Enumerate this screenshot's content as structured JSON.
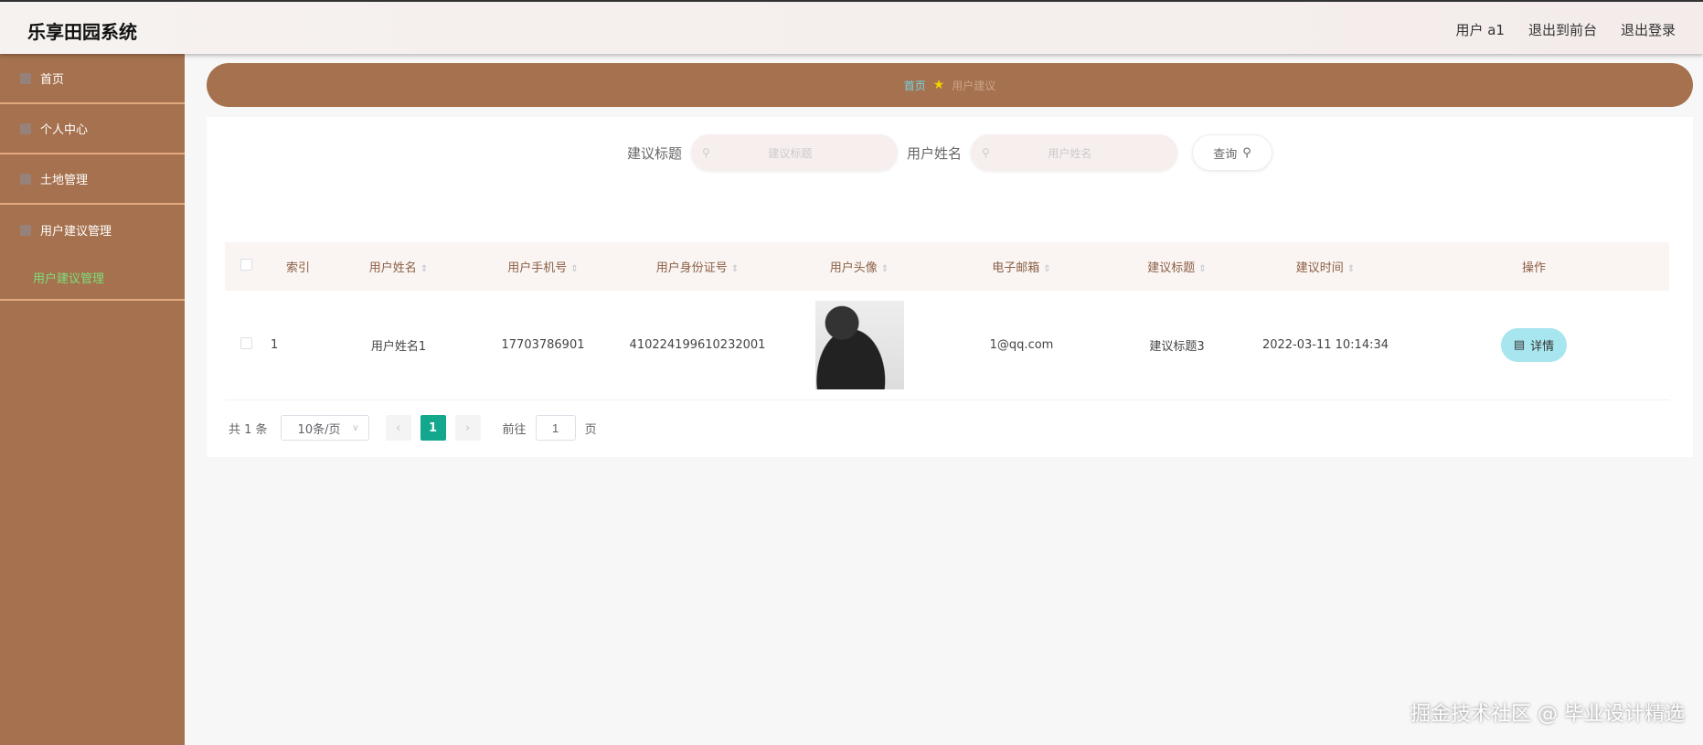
{
  "header": {
    "title": "乐享田园系统",
    "user": "用户 a1",
    "to_front": "退出到前台",
    "logout": "退出登录"
  },
  "sidebar": {
    "items": [
      {
        "label": "首页"
      },
      {
        "label": "个人中心"
      },
      {
        "label": "土地管理"
      },
      {
        "label": "用户建议管理"
      }
    ],
    "sub_item": "用户建议管理"
  },
  "breadcrumb": {
    "home": "首页",
    "current": "用户建议"
  },
  "search": {
    "title_label": "建议标题",
    "title_placeholder": "建议标题",
    "name_label": "用户姓名",
    "name_placeholder": "用户姓名",
    "query_button": "查询"
  },
  "table": {
    "headers": [
      "索引",
      "用户姓名",
      "用户手机号",
      "用户身份证号",
      "用户头像",
      "电子邮箱",
      "建议标题",
      "建议时间",
      "操作"
    ],
    "rows": [
      {
        "index": "1",
        "name": "用户姓名1",
        "phone": "17703786901",
        "id_card": "410224199610232001",
        "email": "1@qq.com",
        "title": "建议标题3",
        "time": "2022-03-11 10:14:34",
        "action": "详情"
      }
    ]
  },
  "pagination": {
    "total": "共 1 条",
    "page_size": "10条/页",
    "current": "1",
    "goto_label": "前往",
    "goto_value": "1",
    "page_suffix": "页"
  },
  "watermark": "掘金技术社区 @ 毕业设计精选"
}
